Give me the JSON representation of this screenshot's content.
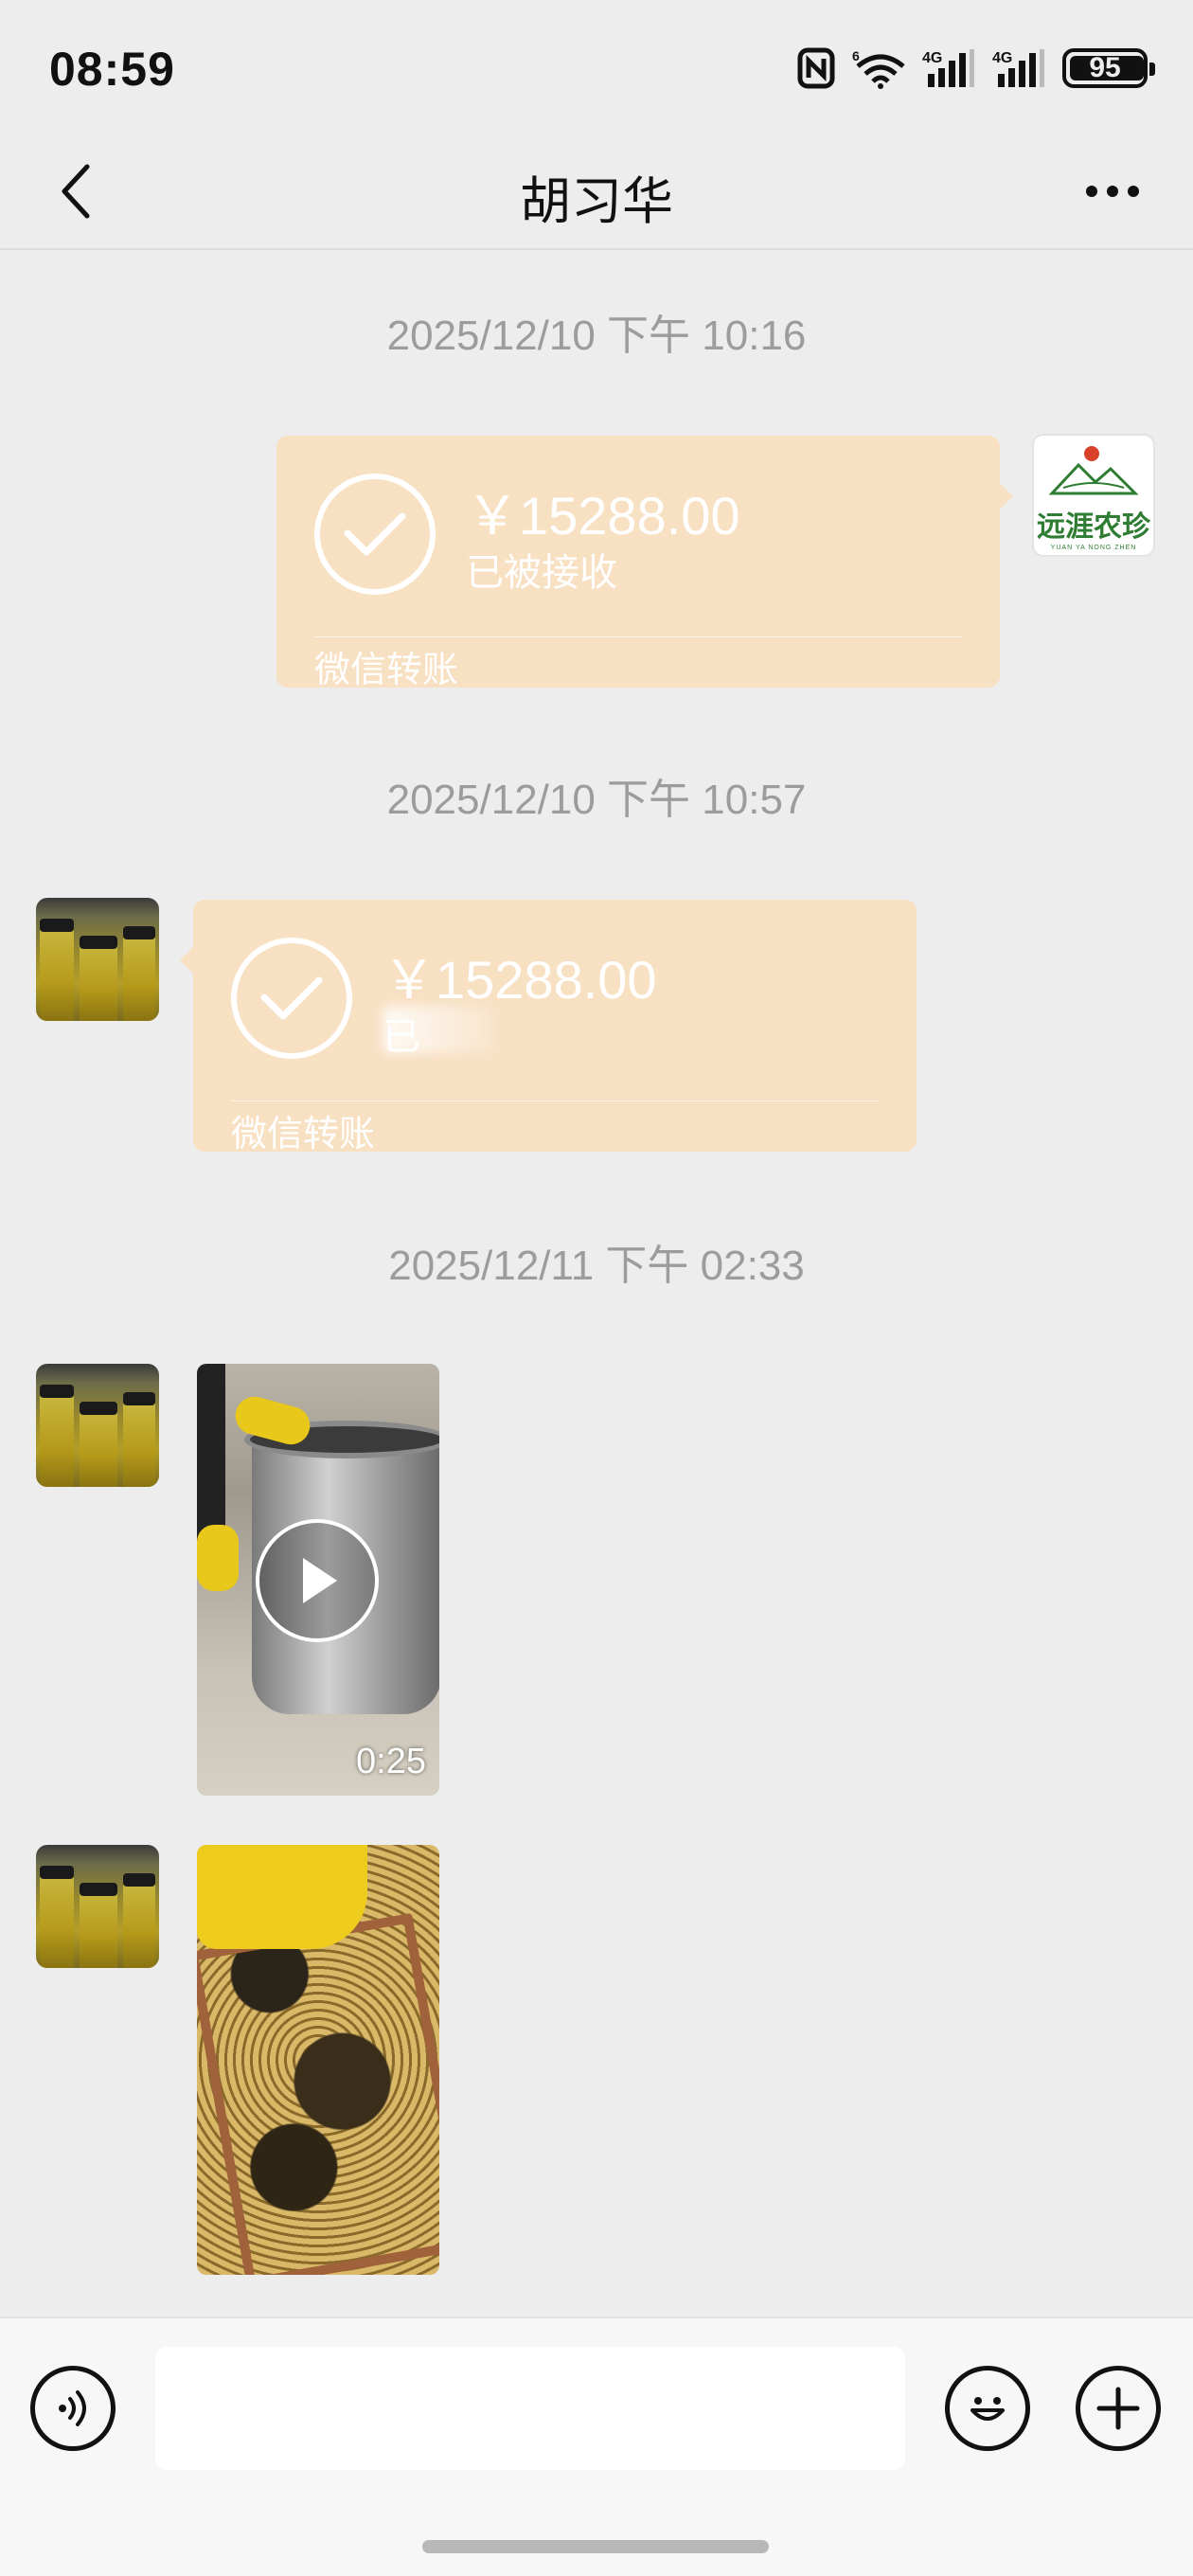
{
  "status_bar": {
    "time": "08:59",
    "battery_level": "95",
    "icons": [
      "nfc-icon",
      "wifi-icon",
      "signal-4g-icon",
      "signal-4g-icon",
      "battery-icon"
    ]
  },
  "header": {
    "title": "胡习华",
    "back_icon": "chevron-left-icon",
    "more_icon": "more-dots-icon"
  },
  "messages": [
    {
      "type": "timestamp",
      "text": "2025/12/10 下午 10:16"
    },
    {
      "type": "transfer",
      "side": "right",
      "amount": "￥15288.00",
      "status": "已被接收",
      "caption": "微信转账",
      "avatar": "logo"
    },
    {
      "type": "timestamp",
      "text": "2025/12/10 下午 10:57"
    },
    {
      "type": "transfer",
      "side": "left",
      "amount": "￥15288.00",
      "status": "已",
      "caption": "微信转账",
      "avatar": "honey"
    },
    {
      "type": "timestamp",
      "text": "2025/12/11 下午 02:33"
    },
    {
      "type": "video",
      "side": "left",
      "duration": "0:25",
      "avatar": "honey"
    },
    {
      "type": "image",
      "side": "left",
      "avatar": "honey"
    }
  ],
  "logo": {
    "name": "远涯农珍",
    "sub": "YUAN YA NONG ZHEN"
  },
  "input_bar": {
    "placeholder": "",
    "icons": [
      "voice-icon",
      "emoji-icon",
      "plus-icon"
    ]
  },
  "colors": {
    "background": "#ededed",
    "transfer_bubble": "#f8e0c3",
    "timestamp": "#9c9c9c",
    "logo_green": "#2e7d32"
  }
}
